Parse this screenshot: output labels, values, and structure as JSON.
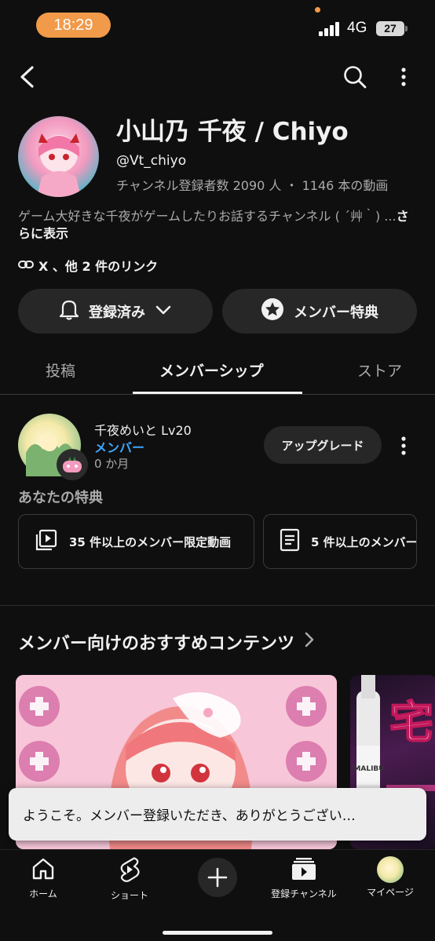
{
  "status_bar": {
    "time": "18:29",
    "network": "4G",
    "battery": "27"
  },
  "top_bar": {
    "icons": [
      "back-arrow-icon",
      "search-icon",
      "more-vert-icon"
    ]
  },
  "channel": {
    "title": "小山乃 千夜 / Chiyo",
    "handle": "@Vt_chiyo",
    "stats": "チャンネル登録者数 2090 人 ・ 1146 本の動画",
    "description": "ゲーム大好きな千夜がゲームしたりお話するチャンネル ( ´艸｀) ...",
    "description_more": "さらに表示",
    "links": "X 、他 2 件のリンク"
  },
  "actions": {
    "subscribed_label": "登録済み",
    "perks_label": "メンバー特典"
  },
  "tabs": [
    {
      "label": "投稿"
    },
    {
      "label": "メンバーシップ"
    },
    {
      "label": "ストア"
    }
  ],
  "membership": {
    "level": "千夜めいと Lv20",
    "status": "メンバー",
    "duration": "0 か月",
    "upgrade_label": "アップグレード",
    "perks_heading": "あなたの特典",
    "perks": [
      {
        "label": "35 件以上のメンバー限定動画"
      },
      {
        "label": "5 件以上のメンバー"
      }
    ]
  },
  "recommended": {
    "heading": "メンバー向けのおすすめコンテンツ",
    "thumb_texts": [
      "宅",
      "MALIBU"
    ]
  },
  "toast": {
    "text": "ようこそ。メンバー登録いただき、ありがとうござい…"
  },
  "bottom_nav": [
    {
      "label": "ホーム"
    },
    {
      "label": "ショート"
    },
    {
      "label": ""
    },
    {
      "label": "登録チャンネル"
    },
    {
      "label": "マイページ"
    }
  ],
  "colors": {
    "background": "#0f0f0f",
    "pill": "#272727",
    "accent_blue": "#3ea6ff",
    "time_pill": "#f19a4a",
    "toast": "#ededed"
  }
}
